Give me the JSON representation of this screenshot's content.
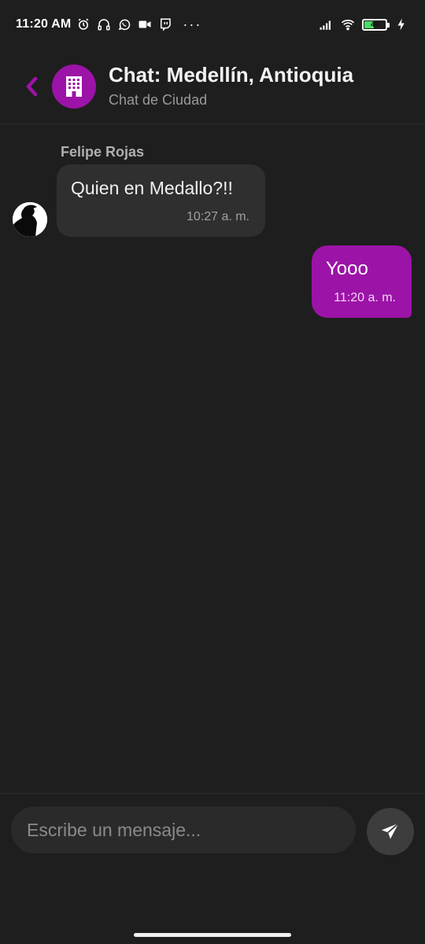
{
  "status_bar": {
    "time": "11:20 AM",
    "dots": "···",
    "battery_level": "48",
    "battery_fraction": 0.48,
    "icons_left": [
      "alarm-icon",
      "headphones-icon",
      "whatsapp-icon",
      "video-icon",
      "twitch-icon"
    ],
    "icons_right": [
      "signal-icon",
      "wifi-icon",
      "battery-icon",
      "charging-icon"
    ]
  },
  "header": {
    "title": "Chat: Medellín, Antioquia",
    "subtitle": "Chat de Ciudad",
    "back_icon": "chevron-left-icon",
    "avatar_icon": "building-icon"
  },
  "messages": [
    {
      "direction": "incoming",
      "sender": "Felipe Rojas",
      "text": "Quien en Medallo?!!",
      "time": "10:27 a. m."
    },
    {
      "direction": "outgoing",
      "text": "Yooo",
      "time": "11:20 a. m."
    }
  ],
  "composer": {
    "placeholder": "Escribe un mensaje...",
    "value": "",
    "send_icon": "send-icon"
  },
  "colors": {
    "background": "#1e1e1e",
    "accent": "#9c13a7",
    "incoming_bubble": "#2f2f2f",
    "input_background": "#2a2a2a",
    "send_button": "#3d3d3d"
  }
}
